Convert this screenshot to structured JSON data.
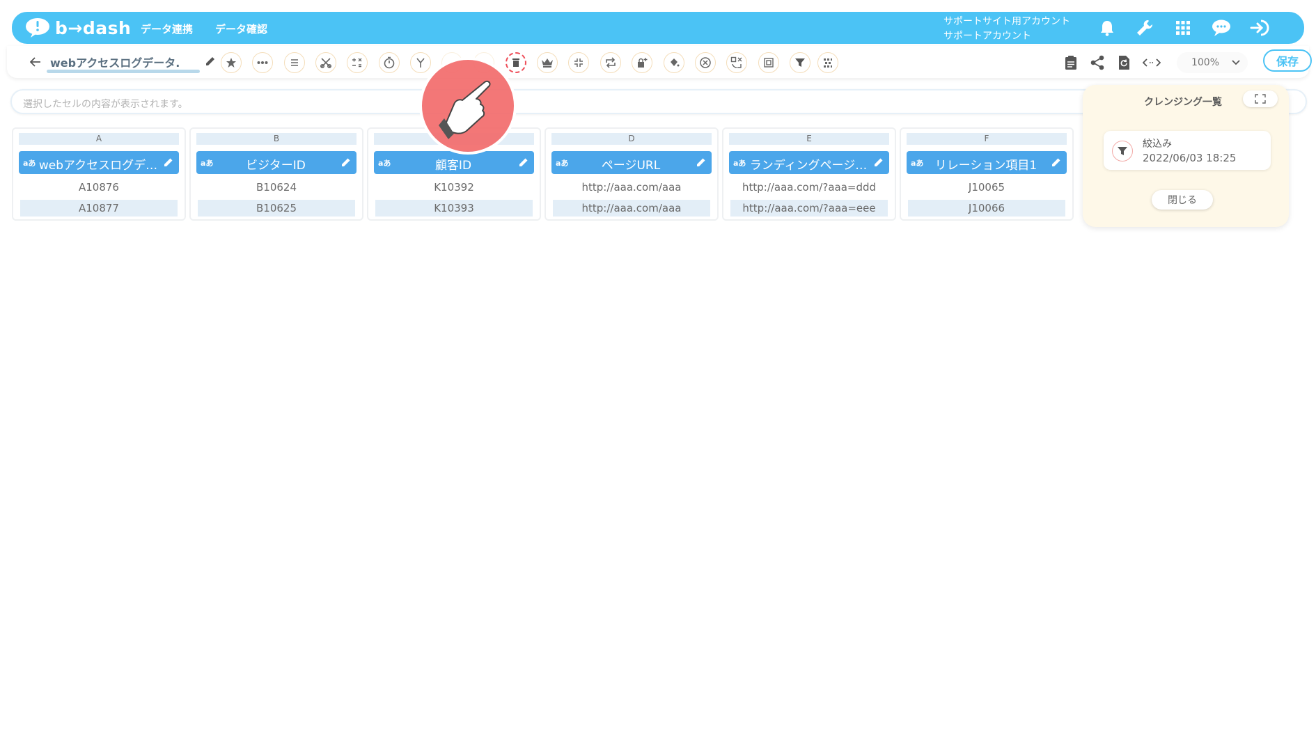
{
  "header": {
    "logo_text": "b→dash",
    "nav": [
      "データ連携",
      "データ確認"
    ],
    "account_line1": "サポートサイト用アカウント",
    "account_line2": "サポートアカウント",
    "brand_color": "#4bc3f5",
    "icons": [
      "bell-icon",
      "wrench-icon",
      "grid-icon",
      "chat-icon",
      "logout-icon"
    ]
  },
  "toolbar": {
    "title": "webアクセスログデータ.",
    "tools": [
      "star",
      "more",
      "list",
      "scissors",
      "calc",
      "timer",
      "merge",
      "blank",
      "blank",
      "trash",
      "crown",
      "collapse",
      "loop",
      "lock-plus",
      "paint",
      "cancel",
      "replace",
      "frame",
      "filter",
      "pattern"
    ],
    "active_tool": "trash",
    "right_icons": [
      "clipboard-icon",
      "share-icon",
      "refresh-icon",
      "code-icon"
    ],
    "zoom": "100%",
    "save": "保存"
  },
  "formula_bar": {
    "placeholder": "選択したセルの内容が表示されます。"
  },
  "columns": [
    {
      "letter": "A",
      "type": "aあ",
      "name": "webアクセスログデ…",
      "rows": [
        "A10876",
        "A10877"
      ]
    },
    {
      "letter": "B",
      "type": "aあ",
      "name": "ビジターID",
      "rows": [
        "B10624",
        "B10625"
      ]
    },
    {
      "letter": "",
      "type": "aあ",
      "name": "顧客ID",
      "rows": [
        "K10392",
        "K10393"
      ]
    },
    {
      "letter": "D",
      "type": "aあ",
      "name": "ページURL",
      "rows": [
        "http://aaa.com/aaa",
        "http://aaa.com/aaa"
      ]
    },
    {
      "letter": "E",
      "type": "aあ",
      "name": "ランディングページ…",
      "rows": [
        "http://aaa.com/?aaa=ddd",
        "http://aaa.com/?aaa=eee"
      ]
    },
    {
      "letter": "F",
      "type": "aあ",
      "name": "リレーション項目1",
      "rows": [
        "J10065",
        "J10066"
      ]
    }
  ],
  "cleansing_panel": {
    "title": "クレンジング一覧",
    "items": [
      {
        "name": "絞込み",
        "date": "2022/06/03 18:25",
        "icon": "filter-icon"
      }
    ],
    "close": "閉じる"
  }
}
